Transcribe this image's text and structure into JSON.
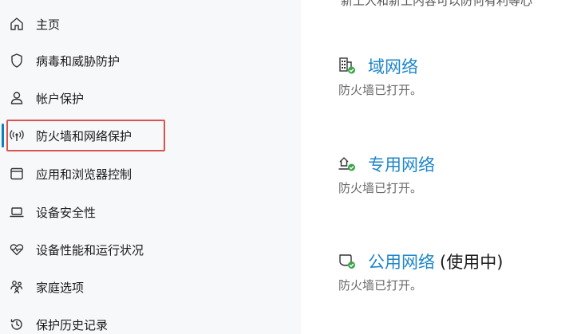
{
  "sidebar": {
    "items": [
      {
        "label": "主页",
        "icon": "home-icon"
      },
      {
        "label": "病毒和威胁防护",
        "icon": "shield-icon"
      },
      {
        "label": "帐户保护",
        "icon": "person-icon"
      },
      {
        "label": "防火墙和网络保护",
        "icon": "wifi-broadcast-icon"
      },
      {
        "label": "应用和浏览器控制",
        "icon": "browser-window-icon"
      },
      {
        "label": "设备安全性",
        "icon": "laptop-icon"
      },
      {
        "label": "设备性能和运行状况",
        "icon": "heart-pulse-icon"
      },
      {
        "label": "家庭选项",
        "icon": "family-icon"
      },
      {
        "label": "保护历史记录",
        "icon": "history-icon"
      }
    ],
    "active_index": 3
  },
  "main": {
    "top_partial_text": "新工人和新工内容可以防何有利等心",
    "networks": [
      {
        "title": "域网络",
        "suffix": "",
        "status": "防火墙已打开。",
        "icon": "domain-building-icon"
      },
      {
        "title": "专用网络",
        "suffix": "",
        "status": "防火墙已打开。",
        "icon": "private-network-icon"
      },
      {
        "title": "公用网络",
        "suffix": "(使用中)",
        "status": "防火墙已打开。",
        "icon": "public-network-icon"
      }
    ]
  },
  "colors": {
    "accent": "#1e86c9",
    "highlight": "#d9544f",
    "check": "#3aa54a"
  }
}
